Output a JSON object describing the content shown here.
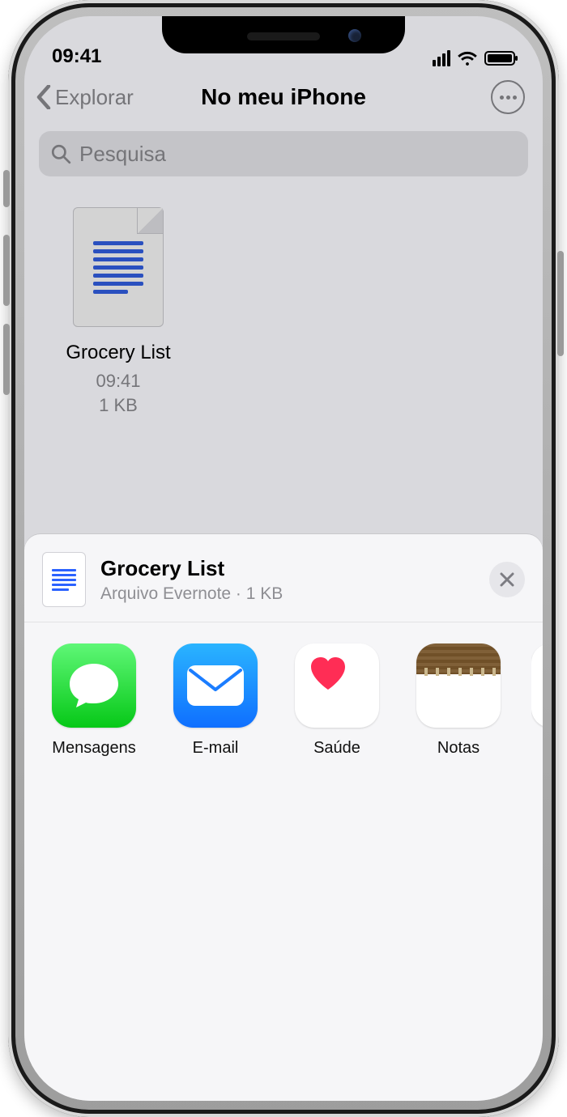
{
  "statusbar": {
    "time": "09:41"
  },
  "nav": {
    "back_label": "Explorar",
    "title": "No meu iPhone"
  },
  "search": {
    "placeholder": "Pesquisa"
  },
  "file": {
    "name": "Grocery List",
    "time": "09:41",
    "size": "1 KB"
  },
  "share": {
    "title": "Grocery List",
    "subtitle": "Arquivo Evernote · 1 KB",
    "apps": [
      {
        "label": "Mensagens"
      },
      {
        "label": "E-mail"
      },
      {
        "label": "Saúde"
      },
      {
        "label": "Notas"
      }
    ]
  }
}
